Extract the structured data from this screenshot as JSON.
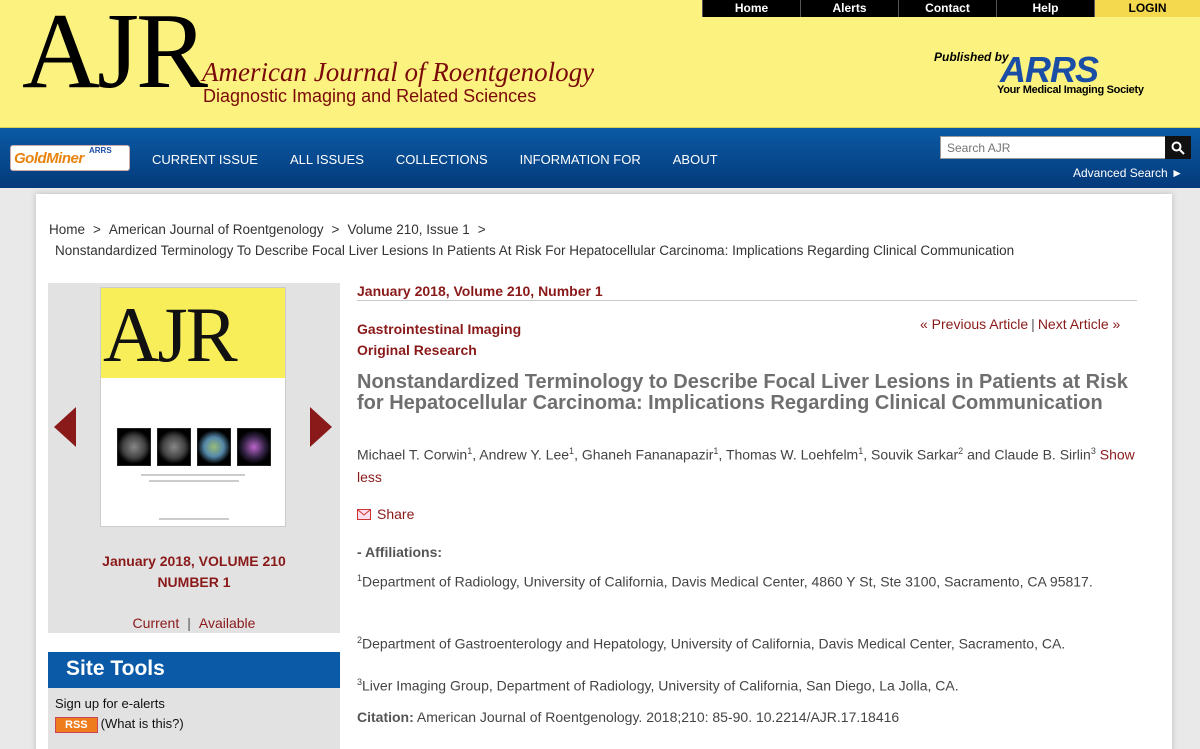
{
  "header": {
    "logo": "AJR",
    "journal_name": "American Journal of Roentgenology",
    "journal_subtitle": "Diagnostic Imaging and Related Sciences",
    "published_by": "Published by",
    "publisher_logo": "ARRS",
    "publisher_tagline": "Your Medical Imaging Society",
    "top_nav": [
      "Home",
      "Alerts",
      "Contact",
      "Help",
      "LOGIN"
    ]
  },
  "navbar": {
    "goldminer": "GoldMiner",
    "goldminer_badge": "ARRS",
    "items": [
      "CURRENT ISSUE",
      "ALL ISSUES",
      "COLLECTIONS",
      "INFORMATION FOR",
      "ABOUT"
    ],
    "search_placeholder": "Search AJR",
    "advanced_search": "Advanced Search ►"
  },
  "breadcrumb": {
    "items": [
      "Home",
      "American Journal of Roentgenology",
      "Volume 210, Issue 1"
    ],
    "separator": ">",
    "current": "Nonstandardized Terminology To Describe Focal Liver Lesions In Patients At Risk For Hepatocellular Carcinoma: Implications Regarding Clinical Communication"
  },
  "cover": {
    "logo": "AJR",
    "date_line1": "January 2018, VOLUME 210",
    "date_line2": "NUMBER 1",
    "link_current": "Current",
    "link_available": "Available",
    "separator": "|"
  },
  "site_tools": {
    "title": "Site Tools",
    "email_alerts": "Sign up for e-alerts",
    "rss_badge": "RSS",
    "rss_help": "(What is this?)"
  },
  "article": {
    "issue": "January 2018, Volume 210, Number 1",
    "section": "Gastrointestinal Imaging",
    "type": "Original Research",
    "prev": "« Previous Article",
    "next": "Next Article »",
    "separator": "|",
    "title": "Nonstandardized Terminology to Describe Focal Liver Lesions in Patients at Risk for Hepatocellular Carcinoma: Implications Regarding Clinical Communication",
    "authors": [
      {
        "name": "Michael T. Corwin",
        "sup": "1",
        "sep": ", "
      },
      {
        "name": "Andrew Y. Lee",
        "sup": "1",
        "sep": ", "
      },
      {
        "name": "Ghaneh Fananapazir",
        "sup": "1",
        "sep": ", "
      },
      {
        "name": "Thomas W. Loehfelm",
        "sup": "1",
        "sep": ", "
      },
      {
        "name": "Souvik Sarkar",
        "sup": "2",
        "sep": " and "
      },
      {
        "name": "Claude B. Sirlin",
        "sup": "3",
        "sep": " "
      }
    ],
    "show_less": "Show less",
    "share": "Share",
    "affiliations_heading": "- Affiliations:",
    "affiliations": [
      {
        "sup": "1",
        "text": "Department of Radiology, University of California, Davis Medical Center, 4860 Y St, Ste 3100, Sacramento, CA 95817."
      },
      {
        "sup": "2",
        "text": "Department of Gastroenterology and Hepatology, University of California, Davis Medical Center, Sacramento, CA."
      },
      {
        "sup": "3",
        "text": "Liver Imaging Group, Department of Radiology, University of California, San Diego, La Jolla, CA."
      }
    ],
    "citation_label": "Citation:",
    "citation_text": "American Journal of Roentgenology. 2018;210: 85-90. 10.2214/AJR.17.18416"
  }
}
